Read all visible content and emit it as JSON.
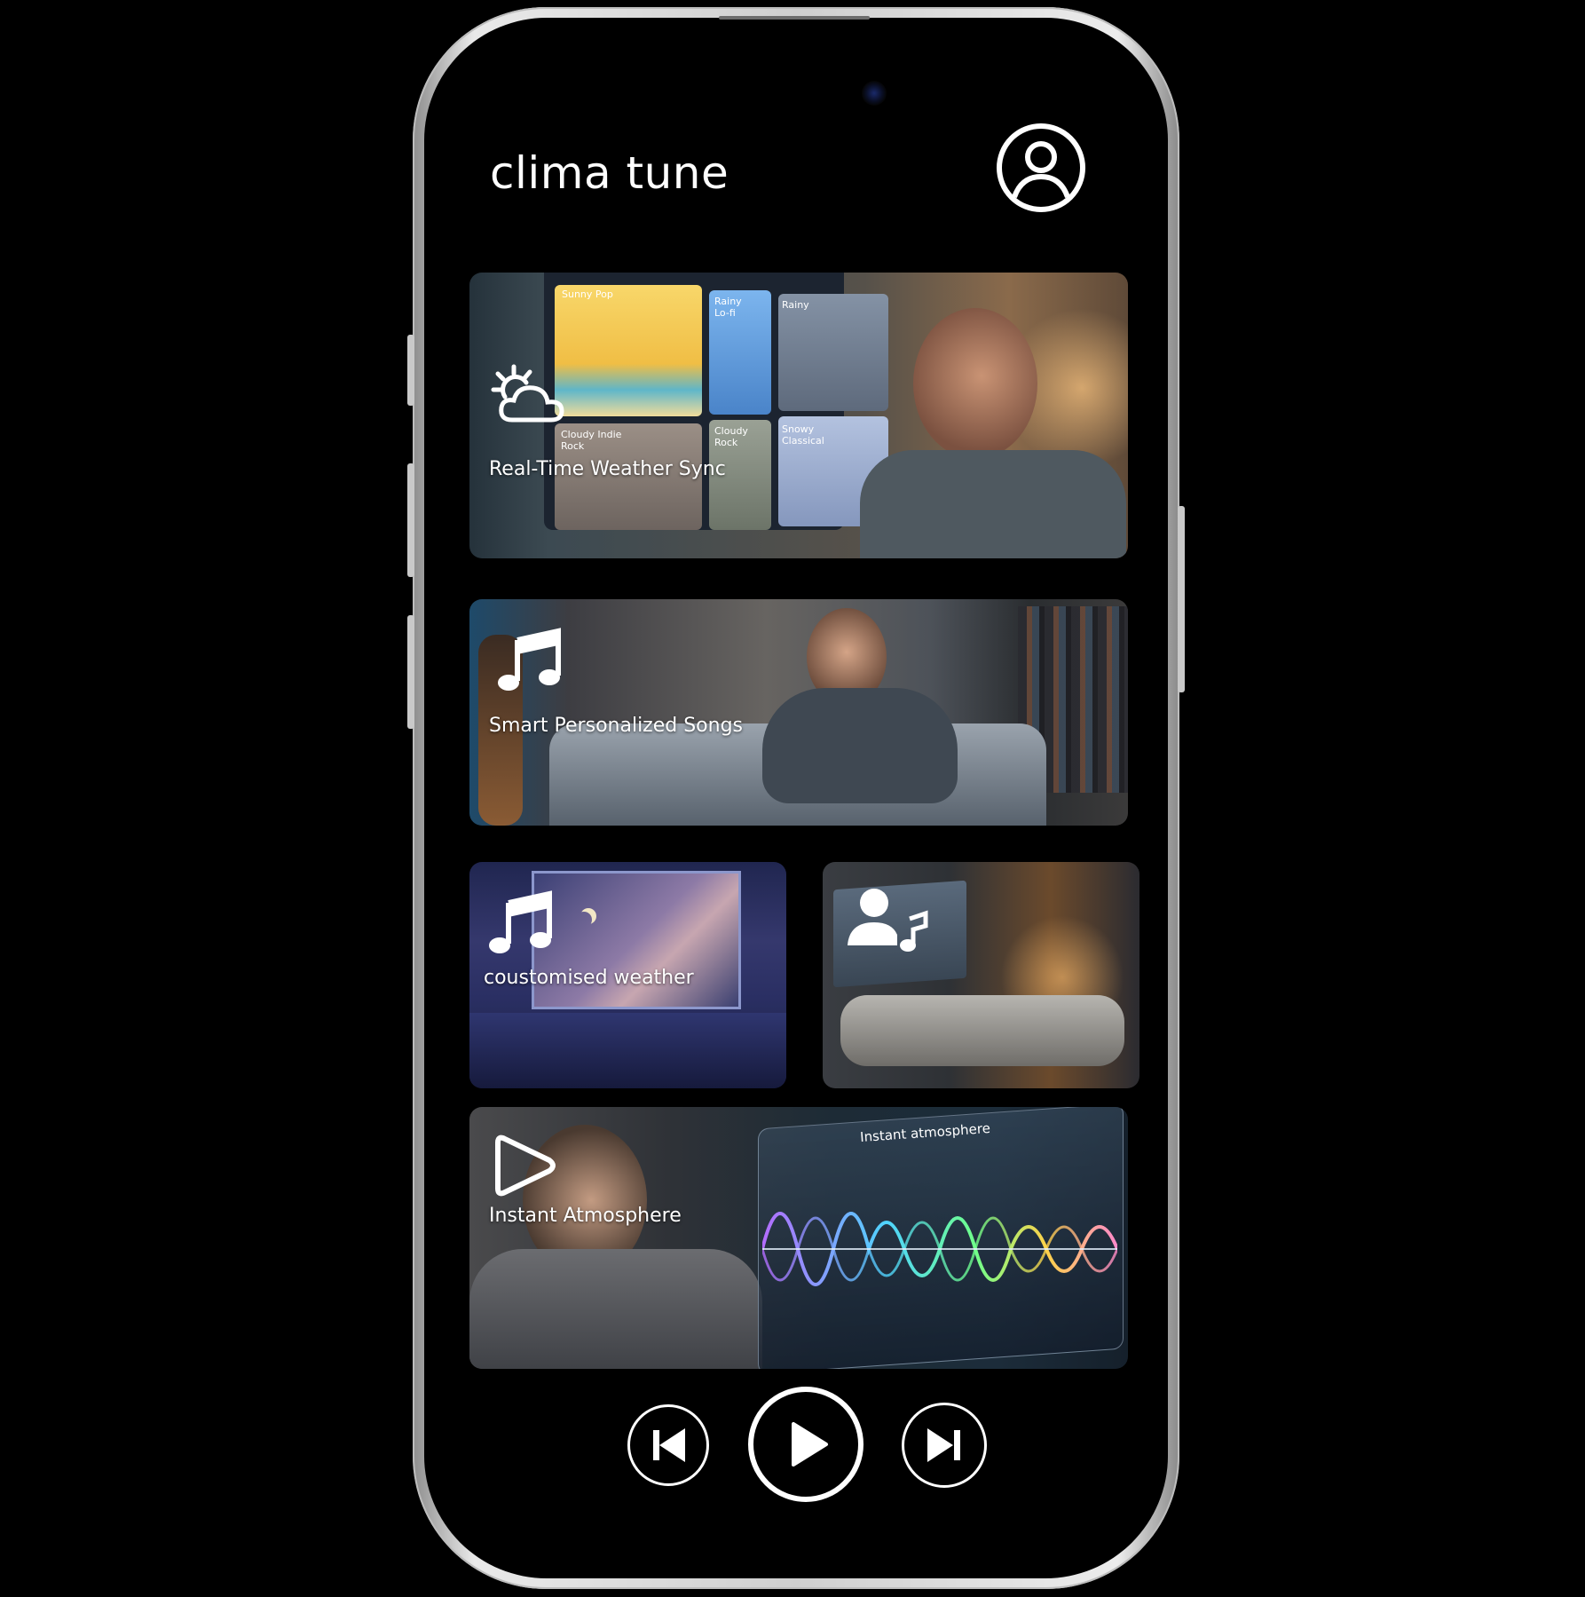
{
  "app": {
    "title": "clima tune",
    "profile_icon": "user-circle-icon"
  },
  "cards": [
    {
      "label": "Real-Time Weather Sync",
      "icon": "sun-cloud-icon",
      "mockup": {
        "tiles": [
          {
            "label": "Sunny Pop",
            "color": "#f3c84b"
          },
          {
            "label": "Rainy Lo-fi",
            "color": "#6aa5e0"
          },
          {
            "label": "Rainy",
            "color": "#6f7b8d"
          },
          {
            "label": "Cloudy Indie Rock",
            "color": "#8b8079"
          },
          {
            "label": "Cloudy Rock",
            "color": "#8d9488"
          },
          {
            "label": "Snowy Classical",
            "color": "#a9b8d6"
          }
        ]
      }
    },
    {
      "label": "Smart Personalized  Songs",
      "icon": "music-note-icon"
    },
    {
      "label": "coustomised weather",
      "icon": "music-note-icon"
    },
    {
      "label": "",
      "icon": "user-music-icon"
    },
    {
      "label": "Instant Atmosphere",
      "icon": "play-outline-icon",
      "panel_title": "Instant atmosphere"
    }
  ],
  "controls": {
    "previous": "skip-back-icon",
    "play": "play-icon",
    "next": "skip-forward-icon"
  },
  "colors": {
    "background": "#000000",
    "text": "#ffffff",
    "frame": "#d9d9d9"
  }
}
